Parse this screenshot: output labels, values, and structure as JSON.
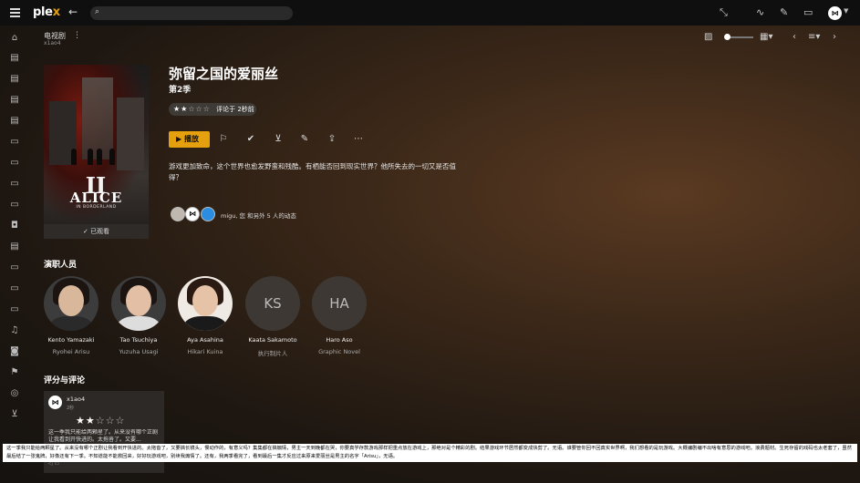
{
  "app": {
    "logo_text": "plex",
    "logo_accent": "#e5a00d"
  },
  "search": {
    "placeholder": ""
  },
  "breadcrumb": {
    "title": "电视剧",
    "subtitle": "x1ao4"
  },
  "show": {
    "title": "弥留之国的爱丽丝",
    "season": "第2季",
    "rating_stars": 2,
    "rating_max": 5,
    "rating_text": "评论于 2秒前",
    "play_label": "播放",
    "summary": "游戏更加致命，这个世界也愈发野蛮和残酷。有栖能否回到现实世界？他所失去的一切又是否值得？",
    "activity_text": "migu, 您 和另外 5 人的动态",
    "watched_label": "已观看"
  },
  "poster": {
    "title": "ALICE",
    "numeral": "II",
    "subtitle": "IN BORDERLAND"
  },
  "cast": {
    "heading": "演职人员",
    "members": [
      {
        "name": "Kento Yamazaki",
        "role": "Ryohei Arisu",
        "initials": ""
      },
      {
        "name": "Tao Tsuchiya",
        "role": "Yuzuha Usagi",
        "initials": ""
      },
      {
        "name": "Aya Asahina",
        "role": "Hikari Kuina",
        "initials": ""
      },
      {
        "name": "Kaata Sakamoto",
        "role": "执行制片人",
        "initials": "KS"
      },
      {
        "name": "Haro Aso",
        "role": "Graphic Novel",
        "initials": "HA"
      }
    ]
  },
  "reviews": {
    "heading": "评分与评论",
    "items": [
      {
        "user": "x1ao4",
        "time": "2秒",
        "stars": 2,
        "text": "这一季我只能给两颗星了。从来没有哪个正剧让我看到开快进的。太拖沓了。又要..."
      }
    ]
  },
  "subtitle_overlay": "这一季我只能给两颗星了。从来没有哪个正剧让我看到开快进的。太拖沓了，又要搞长镜头，慢动作的，有意义吗？集集都在搞煽情，男主一天到晚都在哭，你要真学存款游戏那样把重点放在游戏上，那绝对是个精彩的剧。结果游戏环节居然都变成快剪了。无语。谁要管你回不回真实世界啊，我们想看的是玩游戏。大概编剧编不出啥有意思的游戏吧。浪费题材。生死存留的戏码也太老套了，虽然最后结了一张鬼牌，好像还有下一季。不知道能不能救回来，好好玩游戏吧，别续我煽情了。还有，我两季看完了，看到最后一集才反应过来原来爱丽丝是男主的名字「Arisu」，无语。"
}
